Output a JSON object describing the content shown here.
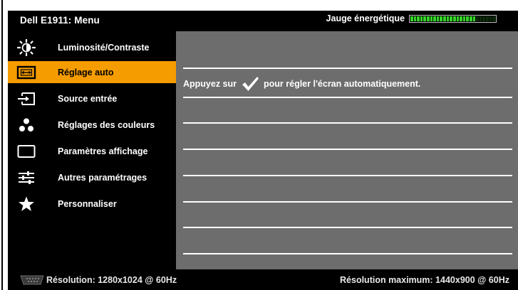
{
  "header": {
    "title": "Dell E1911: Menu",
    "energy_label": "Jauge énergétique",
    "energy_level": 0.75
  },
  "menu": {
    "items": [
      {
        "label": "Luminosité/Contraste",
        "icon": "brightness-icon"
      },
      {
        "label": "Réglage auto",
        "icon": "auto-adjust-icon",
        "active": true
      },
      {
        "label": "Source entrée",
        "icon": "input-source-icon"
      },
      {
        "label": "Réglages des couleurs",
        "icon": "color-settings-icon"
      },
      {
        "label": "Paramètres affichage",
        "icon": "display-settings-icon"
      },
      {
        "label": "Autres paramétrages",
        "icon": "other-settings-icon"
      },
      {
        "label": "Personnaliser",
        "icon": "star-icon"
      }
    ]
  },
  "panel": {
    "msg_before": "Appuyez sur",
    "msg_after": "pour régler l'écran automatiquement."
  },
  "footer": {
    "resolution": "Résolution: 1280x1024 @ 60Hz",
    "max_resolution": "Résolution maximum: 1440x900 @ 60Hz"
  },
  "colors": {
    "accent": "#f59c00",
    "panel": "#6d6d6d",
    "gauge": "#35d42a"
  }
}
